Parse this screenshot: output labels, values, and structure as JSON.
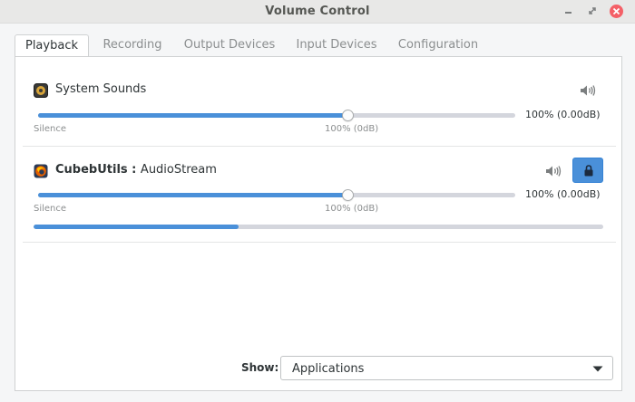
{
  "window": {
    "title": "Volume Control"
  },
  "tabs": [
    {
      "label": "Playback",
      "active": true
    },
    {
      "label": "Recording"
    },
    {
      "label": "Output Devices"
    },
    {
      "label": "Input Devices"
    },
    {
      "label": "Configuration"
    }
  ],
  "streams": [
    {
      "icon": "system-sounds-icon",
      "name": "System Sounds",
      "volume_label": "100% (0.00dB)",
      "volume_fraction": 0.65,
      "min_label": "Silence",
      "mark_label": "100% (0dB)"
    },
    {
      "icon": "firefox-icon",
      "app": "CubebUtils",
      "separator": " : ",
      "name": "AudioStream",
      "volume_label": "100% (0.00dB)",
      "volume_fraction": 0.65,
      "min_label": "Silence",
      "mark_label": "100% (0dB)",
      "peak_level": 0.36
    }
  ],
  "footer": {
    "show_label": "Show:",
    "show_value": "Applications"
  },
  "colors": {
    "accent": "#4a90d9",
    "close": "#f46067",
    "track": "#d4d6dd"
  }
}
